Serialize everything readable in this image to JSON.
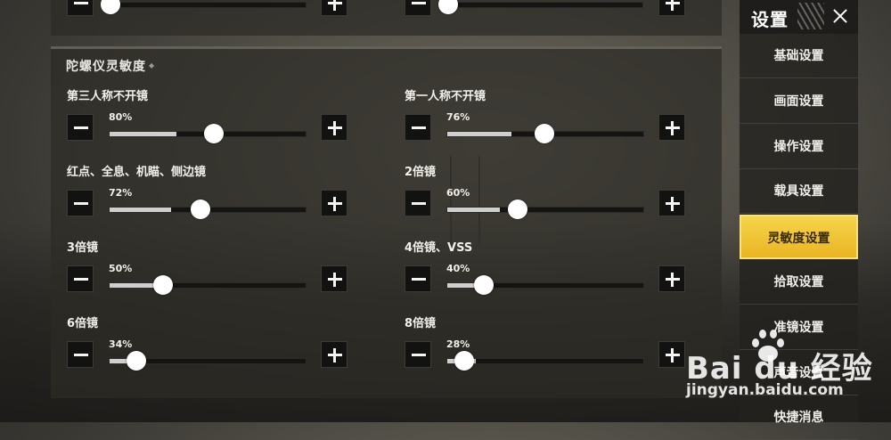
{
  "section": {
    "title": "陀螺仪灵敏度"
  },
  "top_row": {
    "left_value": 0.0,
    "right_value": 0.0
  },
  "sliders": [
    {
      "label": "第三人称不开镜",
      "value": 80,
      "pct": "80%"
    },
    {
      "label": "第一人称不开镜",
      "value": 76,
      "pct": "76%"
    },
    {
      "label": "红点、全息、机瞄、侧边镜",
      "value": 72,
      "pct": "72%"
    },
    {
      "label": "2倍镜",
      "value": 60,
      "pct": "60%"
    },
    {
      "label": "3倍镜",
      "value": 50,
      "pct": "50%"
    },
    {
      "label": "4倍镜、VSS",
      "value": 40,
      "pct": "40%"
    },
    {
      "label": "6倍镜",
      "value": 34,
      "pct": "34%"
    },
    {
      "label": "8倍镜",
      "value": 28,
      "pct": "28%"
    }
  ],
  "sidebar": {
    "title": "设置",
    "items": [
      {
        "label": "基础设置"
      },
      {
        "label": "画面设置"
      },
      {
        "label": "操作设置"
      },
      {
        "label": "载具设置"
      },
      {
        "label": "灵敏度设置",
        "active": true
      },
      {
        "label": "拾取设置"
      },
      {
        "label": "准镜设置"
      },
      {
        "label": "声音设置"
      },
      {
        "label": "快捷消息"
      }
    ]
  },
  "watermark": {
    "brand": "Bai du 经验",
    "url": "jingyan.baidu.com"
  },
  "colors": {
    "accent": "#f0c232",
    "knob": "#ffffff",
    "track_fill": "#cfcfcf"
  }
}
